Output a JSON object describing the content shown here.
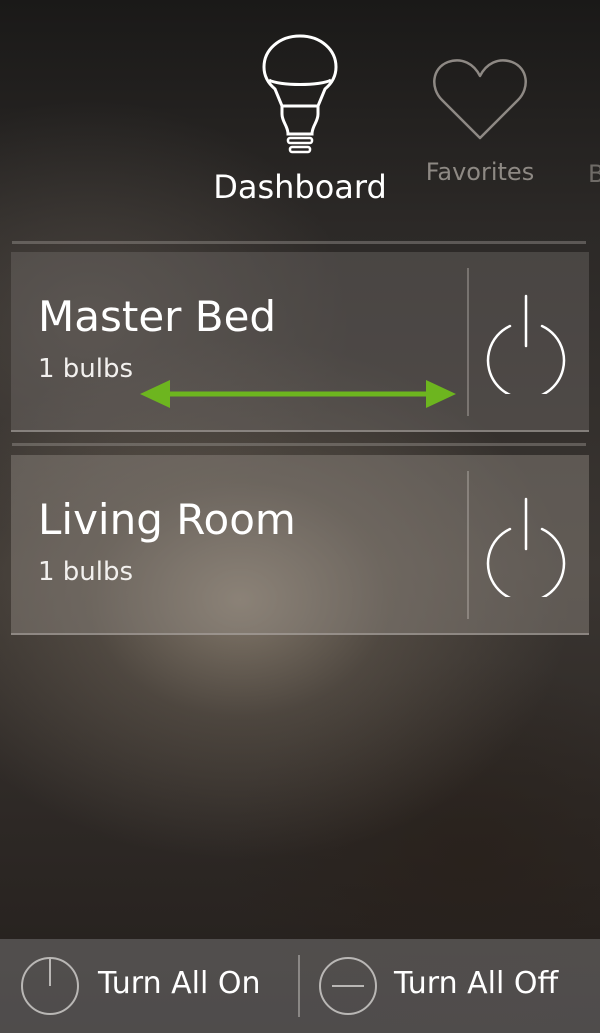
{
  "tabs": {
    "dashboard": {
      "label": "Dashboard",
      "icon": "bulb-icon"
    },
    "favorites": {
      "label": "Favorites",
      "icon": "heart-icon"
    },
    "partial": {
      "label": "B"
    }
  },
  "rooms": [
    {
      "name": "Master Bed",
      "bulbs": "1 bulbs",
      "power_icon": "power-icon"
    },
    {
      "name": "Living Room",
      "bulbs": "1 bulbs",
      "power_icon": "power-icon"
    }
  ],
  "bottom": {
    "turn_all_on": "Turn All On",
    "turn_all_off": "Turn All Off"
  },
  "colors": {
    "swipe_arrow": "#6db51f",
    "text": "#ffffff",
    "inactive_tab": "#8e8984"
  }
}
